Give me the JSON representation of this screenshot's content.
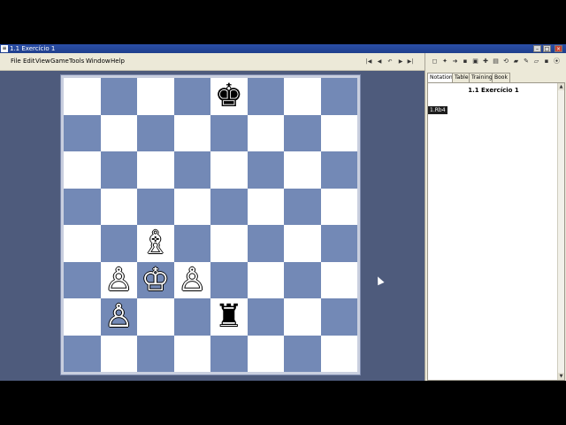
{
  "window": {
    "title": "1.1 Exercício 1",
    "app_icon": "≡",
    "min_glyph": "–",
    "max_glyph": "□",
    "close_glyph": "×"
  },
  "menu": {
    "items": [
      "File",
      "Edit",
      "View",
      "Game",
      "Tools",
      "Window",
      "Help"
    ]
  },
  "nav": {
    "first": "|◀",
    "prev": "◀",
    "undo": "↶",
    "next": "▶",
    "last": "▶|"
  },
  "board": {
    "squares_light": "#ffffff",
    "squares_dark": "#7389b6",
    "pieces": [
      {
        "square": "e8",
        "symbol": "♚",
        "color": "black",
        "name": "black-king"
      },
      {
        "square": "c4",
        "symbol": "♗",
        "color": "white",
        "name": "white-bishop"
      },
      {
        "square": "b3",
        "symbol": "♙",
        "color": "white",
        "name": "white-pawn-b3"
      },
      {
        "square": "c3",
        "symbol": "♔",
        "color": "white",
        "name": "white-king"
      },
      {
        "square": "d3",
        "symbol": "♙",
        "color": "white",
        "name": "white-pawn-d3"
      },
      {
        "square": "b2",
        "symbol": "♙",
        "color": "white",
        "name": "white-pawn-b2"
      },
      {
        "square": "e2",
        "symbol": "♜",
        "color": "black",
        "name": "black-rook"
      }
    ]
  },
  "panel": {
    "tools": [
      "◻",
      "✦",
      "➜",
      "▪",
      "▣",
      "✚",
      "▤",
      "⟲",
      "▰",
      "✎",
      "▱",
      "▪",
      "⦿"
    ],
    "tabs": [
      "Notation",
      "Table",
      "Training",
      "Book"
    ],
    "active_tab": "Notation",
    "game_title": "1.1 Exercício 1",
    "moves": [
      "1.Rb4"
    ],
    "scroll_up": "▲",
    "scroll_down": "▼"
  }
}
